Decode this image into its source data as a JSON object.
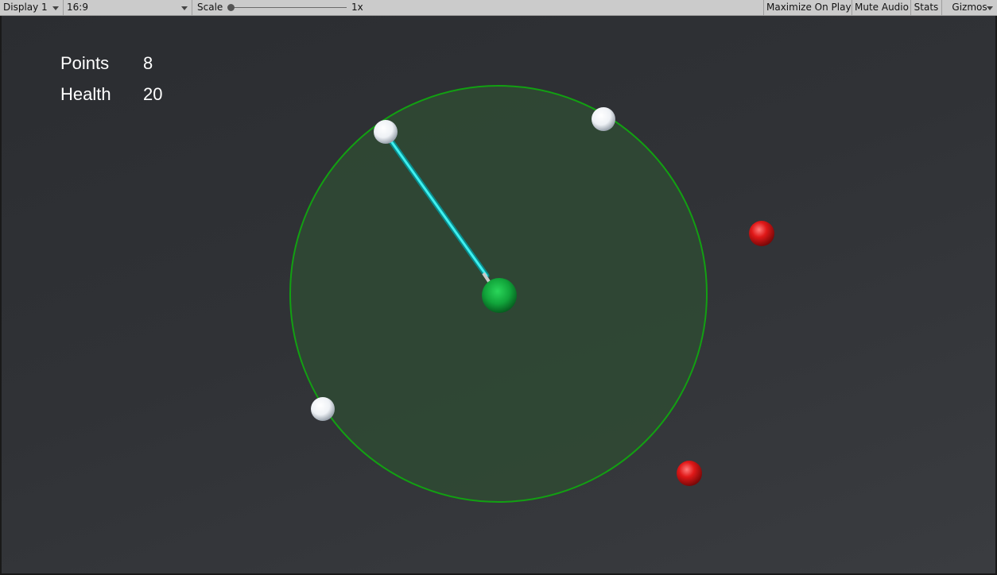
{
  "toolbar": {
    "display_label": "Display 1",
    "aspect_label": "16:9",
    "scale_label": "Scale",
    "scale_value": "1x",
    "scale_fraction": 0.0,
    "maximize_label": "Maximize On Play",
    "mute_label": "Mute Audio",
    "stats_label": "Stats",
    "gizmos_label": "Gizmos"
  },
  "hud": {
    "points_label": "Points",
    "points_value": "8",
    "health_label": "Health",
    "health_value": "20"
  },
  "colors": {
    "range_fill": "#2f4a34",
    "range_stroke": "#12a012",
    "beam": "#19d0d0",
    "player": "#11a43a",
    "friendly_ball": "#ffffff",
    "enemy_ball": "#e01818"
  },
  "icons": {
    "dropdown_arrow": "chevron-down-icon",
    "scale_thumb": "slider-thumb-icon"
  }
}
